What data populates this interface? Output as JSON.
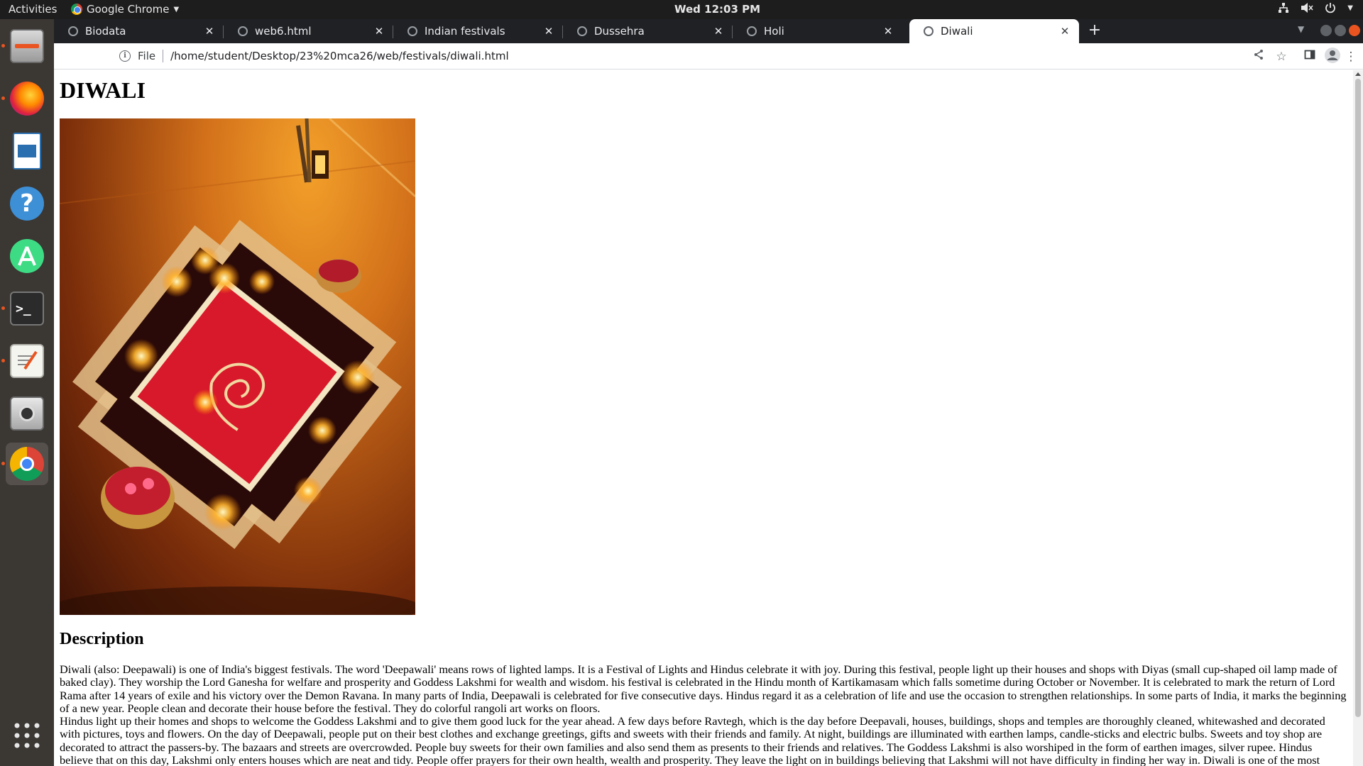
{
  "topbar": {
    "activities": "Activities",
    "app_name": "Google Chrome",
    "clock": "Wed 12:03 PM"
  },
  "dock": {
    "items": [
      {
        "name": "files",
        "icon": "file-cabinet-icon"
      },
      {
        "name": "firefox",
        "icon": "firefox-icon"
      },
      {
        "name": "writer",
        "icon": "document-icon"
      },
      {
        "name": "help",
        "icon": "help-icon"
      },
      {
        "name": "android-studio",
        "icon": "android-studio-icon"
      },
      {
        "name": "terminal",
        "icon": "terminal-icon"
      },
      {
        "name": "text-editor",
        "icon": "text-editor-icon"
      },
      {
        "name": "screenshot",
        "icon": "camera-icon"
      },
      {
        "name": "chrome",
        "icon": "chrome-icon"
      },
      {
        "name": "show-apps",
        "icon": "app-grid-icon"
      }
    ]
  },
  "browser": {
    "tabs": [
      {
        "title": "Biodata"
      },
      {
        "title": "web6.html"
      },
      {
        "title": "Indian festivals"
      },
      {
        "title": "Dussehra"
      },
      {
        "title": "Holi"
      },
      {
        "title": "Diwali"
      }
    ],
    "active_tab": 5,
    "scheme_label": "File",
    "url": "/home/student/Desktop/23%20mca26/web/festivals/diwali.html"
  },
  "page": {
    "title": "DIWALI",
    "image_alt": "Diwali rangoli with lit diyas",
    "section_heading": "Description",
    "paragraph_1": "Diwali (also: Deepawali) is one of India's biggest festivals. The word 'Deepawali' means rows of lighted lamps. It is a Festival of Lights and Hindus celebrate it with joy. During this festival, people light up their houses and shops with Diyas (small cup-shaped oil lamp made of baked clay). They worship the Lord Ganesha for welfare and prosperity and Goddess Lakshmi for wealth and wisdom. his festival is celebrated in the Hindu month of Kartikamasam which falls sometime during October or November. It is celebrated to mark the return of Lord Rama after 14 years of exile and his victory over the Demon Ravana. In many parts of India, Deepawali is celebrated for five consecutive days. Hindus regard it as a celebration of life and use the occasion to strengthen relationships. In some parts of India, it marks the beginning of a new year. People clean and decorate their house before the festival. They do colorful rangoli art works on floors.",
    "paragraph_2": "Hindus light up their homes and shops to welcome the Goddess Lakshmi and to give them good luck for the year ahead. A few days before Ravtegh, which is the day before Deepavali, houses, buildings, shops and temples are thoroughly cleaned, whitewashed and decorated with pictures, toys and flowers. On the day of Deepawali, people put on their best clothes and exchange greetings, gifts and sweets with their friends and family. At night, buildings are illuminated with earthen lamps, candle-sticks and electric bulbs. Sweets and toy shop are decorated to attract the passers-by. The bazaars and streets are overcrowded. People buy sweets for their own families and also send them as presents to their friends and relatives. The Goddess Lakshmi is also worshiped in the form of earthen images, silver rupee. Hindus believe that on this day, Lakshmi only enters houses which are neat and tidy. People offer prayers for their own health, wealth and prosperity. They leave the light on in buildings believing that Lakshmi will not have difficulty in finding her way in. Diwali is one of the most important festival of the Hindus.It"
  },
  "colors": {
    "topbar_bg": "#1d1d1d",
    "dock_bg": "#3b3733",
    "tabstrip_bg": "#202124",
    "ubuntu_orange": "#e95420"
  }
}
